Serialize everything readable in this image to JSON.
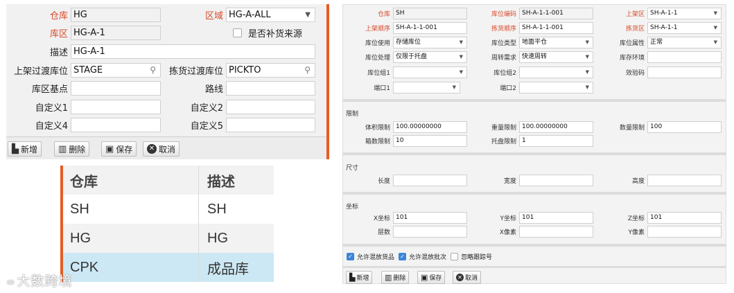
{
  "zone_form": {
    "warehouse_label": "仓库",
    "warehouse_value": "HG",
    "region_label": "区域",
    "region_value": "HG-A-ALL",
    "zone_label": "库区",
    "zone_value": "HG-A-1",
    "replenish_source_label": "是否补货来源",
    "desc_label": "描述",
    "desc_value": "HG-A-1",
    "putaway_transit_label": "上架过渡库位",
    "putaway_transit_value": "STAGE",
    "picking_transit_label": "拣货过渡库位",
    "picking_transit_value": "PICKTO",
    "zone_base_label": "库区基点",
    "zone_base_value": "",
    "route_label": "路线",
    "route_value": "",
    "custom1_label": "自定义1",
    "custom1_value": "",
    "custom2_label": "自定义2",
    "custom2_value": "",
    "custom4_label": "自定义4",
    "custom4_value": "",
    "custom5_label": "自定义5",
    "custom5_value": "",
    "accent_color": "#e65c24"
  },
  "zone_toolbar": {
    "add": "新增",
    "delete": "删除",
    "save": "保存",
    "cancel": "取消"
  },
  "warehouse_table": {
    "headers": [
      "仓库",
      "描述"
    ],
    "rows": [
      {
        "code": "SH",
        "desc": "SH"
      },
      {
        "code": "HG",
        "desc": "HG"
      },
      {
        "code": "CPK",
        "desc": "成品库"
      }
    ],
    "selected_color": "#cde8f5"
  },
  "watermark": {
    "text": "大数跨境"
  },
  "location_form": {
    "warehouse_label": "仓库",
    "warehouse_value": "SH",
    "loc_code_label": "库位编码",
    "loc_code_value": "SH-A-1-1-001",
    "putaway_zone_label": "上架区",
    "putaway_zone_value": "SH-A-1-1",
    "putaway_seq_label": "上架顺序",
    "putaway_seq_value": "SH-A-1-1-001",
    "pick_seq_label": "拣货顺序",
    "pick_seq_value": "SH-A-1-1-001",
    "pick_zone_label": "拣货区",
    "pick_zone_value": "SH-A-1-1",
    "loc_use_label": "库位使用",
    "loc_use_value": "存储库位",
    "loc_type_label": "库位类型",
    "loc_type_value": "地面平仓",
    "loc_attr_label": "库位属性",
    "loc_attr_value": "正常",
    "loc_handling_label": "库位处理",
    "loc_handling_value": "仅限于托盘",
    "turnover_label": "周转需求",
    "turnover_value": "快速周转",
    "env_label": "库存环境",
    "env_value": "",
    "group1_label": "库位组1",
    "group1_value": "",
    "group2_label": "库位组2",
    "group2_value": "",
    "check_code_label": "效验码",
    "check_code_value": "",
    "port1_label": "端口1",
    "port1_value": "",
    "port2_label": "端口2",
    "port2_value": "",
    "limits_section": "限制",
    "volume_limit_label": "体积限制",
    "volume_limit_value": "100.00000000",
    "weight_limit_label": "重量限制",
    "weight_limit_value": "100.00000000",
    "qty_limit_label": "数量限制",
    "qty_limit_value": "100",
    "box_limit_label": "箱数限制",
    "box_limit_value": "10",
    "pallet_limit_label": "托盘限制",
    "pallet_limit_value": "1",
    "size_section": "尺寸",
    "length_label": "长度",
    "width_label": "宽度",
    "height_label": "高度",
    "coord_section": "坐标",
    "x_label": "X坐标",
    "x_value": "101",
    "y_label": "Y坐标",
    "y_value": "101",
    "z_label": "Z坐标",
    "z_value": "101",
    "layers_label": "层数",
    "xpx_label": "X像素",
    "ypx_label": "Y像素",
    "allow_mixed_goods": "允许混放货品",
    "allow_mixed_batch": "允许混放批次",
    "ignore_tracking": "忽略跟踪号",
    "mixed_goods_checked": true,
    "mixed_batch_checked": true,
    "ignore_tracking_checked": false
  },
  "location_toolbar": {
    "add": "新增",
    "delete": "删除",
    "save": "保存",
    "cancel": "取消"
  }
}
